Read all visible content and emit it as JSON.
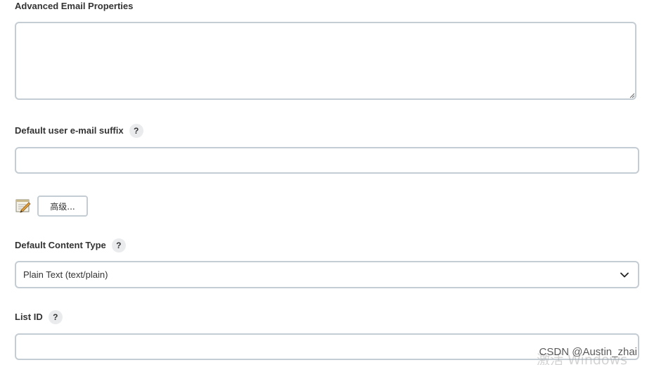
{
  "advanced_email": {
    "label": "Advanced Email Properties",
    "value": ""
  },
  "default_suffix": {
    "label": "Default user e-mail suffix",
    "help": "?",
    "value": ""
  },
  "advanced": {
    "button_label": "高级..."
  },
  "content_type": {
    "label": "Default Content Type",
    "help": "?",
    "selected": "Plain Text (text/plain)"
  },
  "list_id": {
    "label": "List ID",
    "help": "?",
    "value": ""
  },
  "watermark": {
    "text": "CSDN @Austin_zhai",
    "ghost": "激活 Windows"
  }
}
